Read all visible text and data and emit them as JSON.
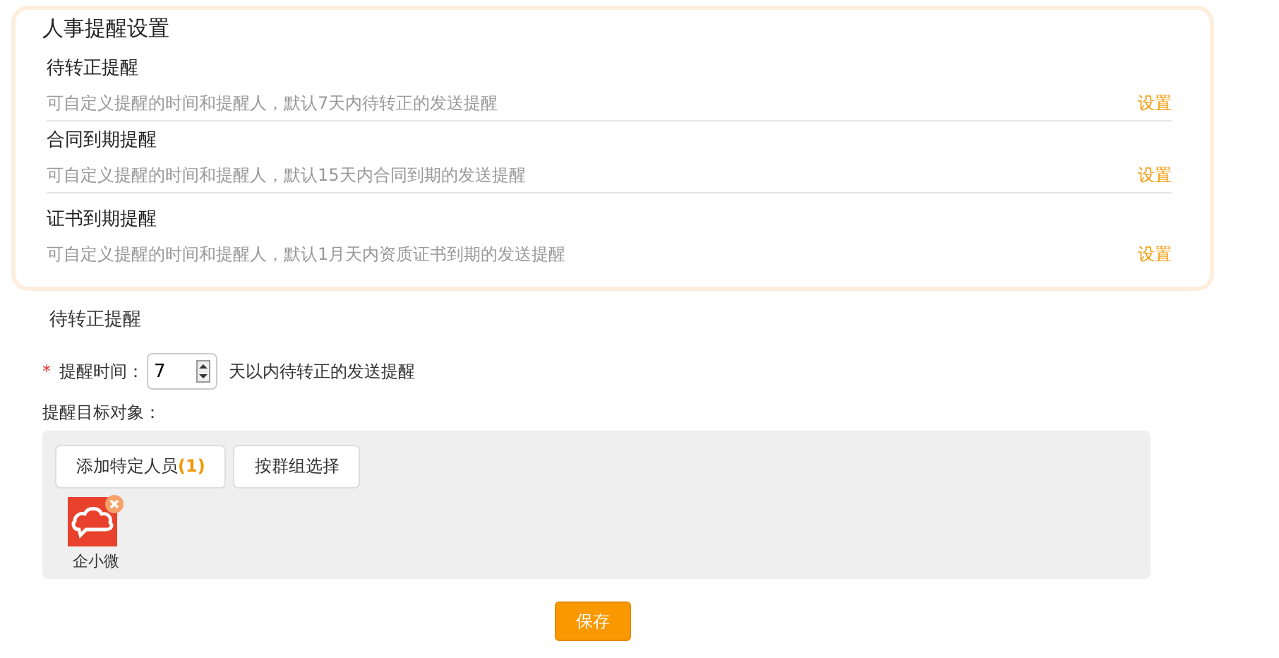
{
  "title": "人事提醒设置",
  "reminders": [
    {
      "name": "待转正提醒",
      "description": "可自定义提醒的时间和提醒人，默认7天内待转正的发送提醒",
      "action": "设置"
    },
    {
      "name": "合同到期提醒",
      "description": "可自定义提醒的时间和提醒人，默认15天内合同到期的发送提醒",
      "action": "设置"
    },
    {
      "name": "证书到期提醒",
      "description": "可自定义提醒的时间和提醒人，默认1月天内资质证书到期的发送提醒",
      "action": "设置"
    }
  ],
  "detail": {
    "title": "待转正提醒",
    "required_mark": "*",
    "time_label": "提醒时间：",
    "time_value": "7",
    "time_suffix": "天以内待转正的发送提醒",
    "targets_label": "提醒目标对象：",
    "buttons": [
      {
        "label": "添加特定人员",
        "count": "(1)"
      },
      {
        "label": "按群组选择"
      }
    ],
    "people": [
      {
        "name": "企小微"
      }
    ]
  },
  "save": "保存"
}
